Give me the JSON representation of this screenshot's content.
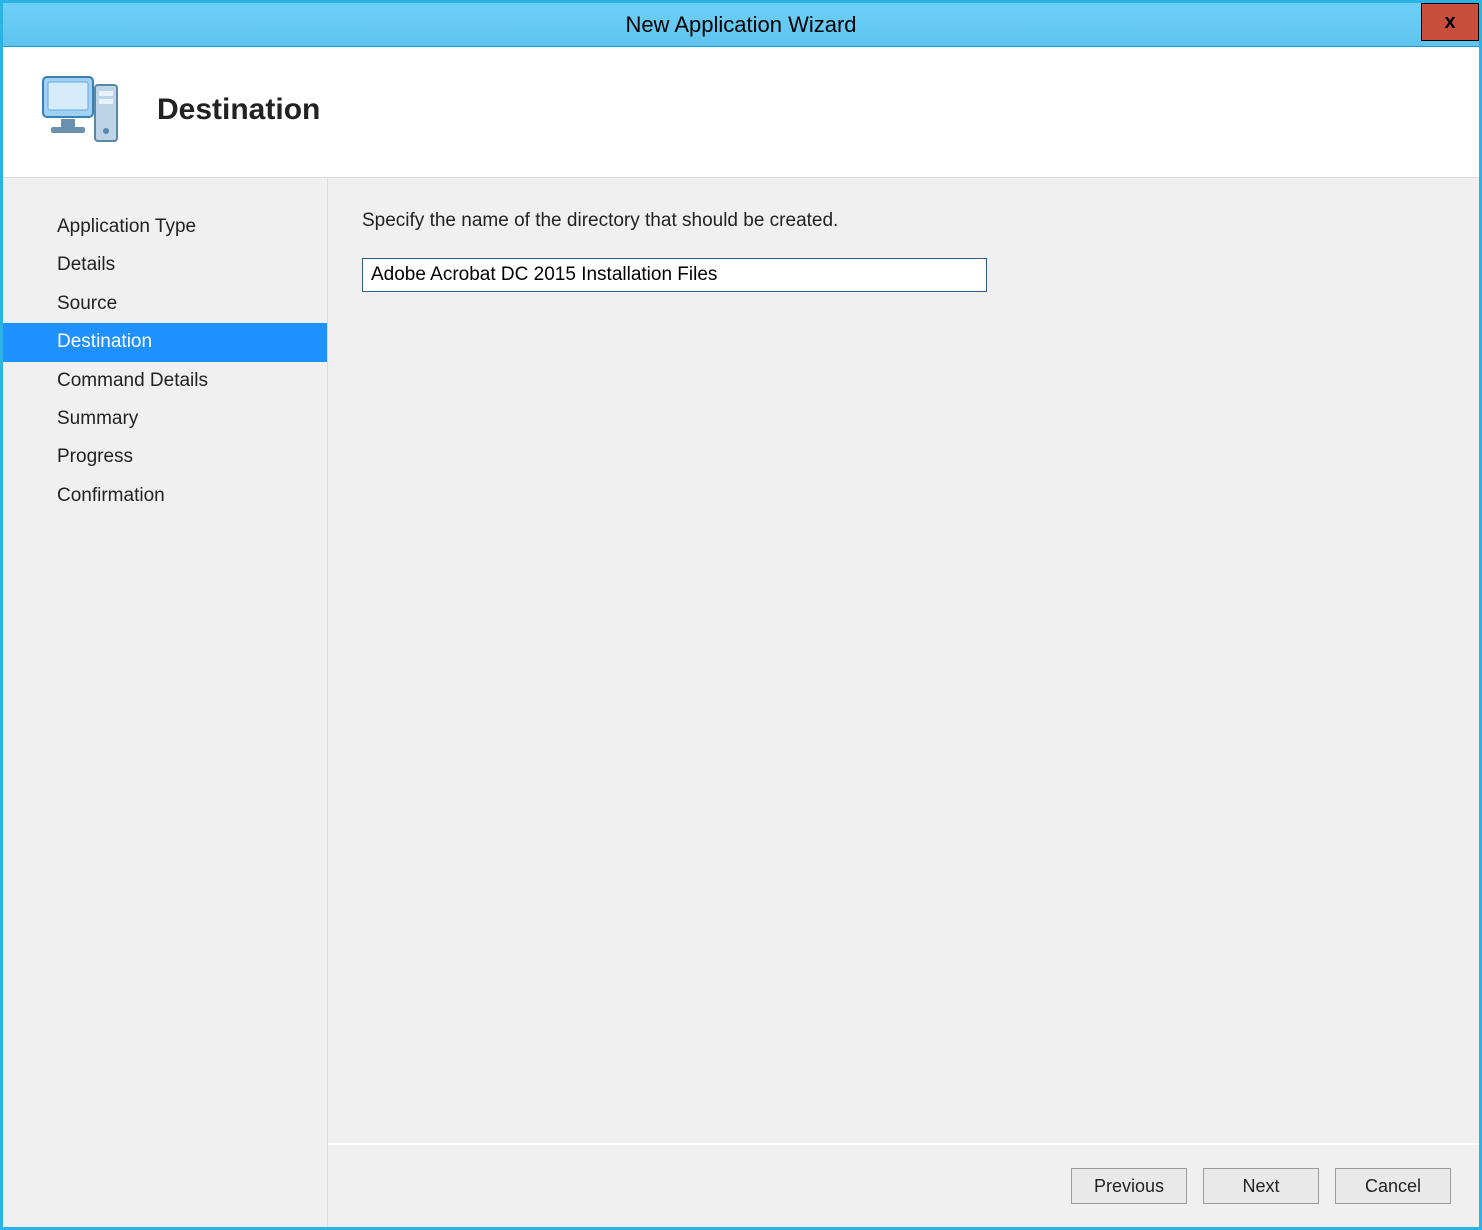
{
  "window": {
    "title": "New Application Wizard",
    "close_label": "x"
  },
  "header": {
    "title": "Destination",
    "icon": "computer-wizard-icon"
  },
  "sidebar": {
    "items": [
      {
        "label": "Application Type",
        "selected": false
      },
      {
        "label": "Details",
        "selected": false
      },
      {
        "label": "Source",
        "selected": false
      },
      {
        "label": "Destination",
        "selected": true
      },
      {
        "label": "Command Details",
        "selected": false
      },
      {
        "label": "Summary",
        "selected": false
      },
      {
        "label": "Progress",
        "selected": false
      },
      {
        "label": "Confirmation",
        "selected": false
      }
    ]
  },
  "main": {
    "instruction": "Specify the name of the directory that should be created.",
    "directory_value": "Adobe Acrobat DC 2015 Installation Files"
  },
  "footer": {
    "previous_label": "Previous",
    "next_label": "Next",
    "cancel_label": "Cancel"
  }
}
